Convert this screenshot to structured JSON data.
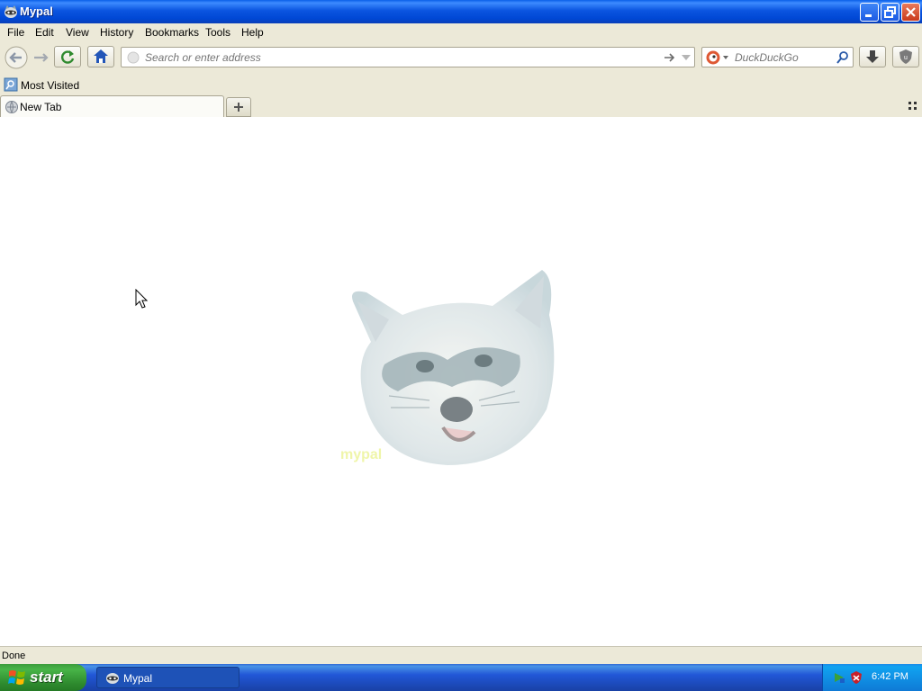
{
  "window": {
    "title": "Mypal"
  },
  "menu": [
    "File",
    "Edit",
    "View",
    "History",
    "Bookmarks",
    "Tools",
    "Help"
  ],
  "navigation": {
    "url_placeholder": "Search or enter address",
    "search_placeholder": "DuckDuckGo"
  },
  "bookmarks": {
    "most_visited": "Most Visited"
  },
  "tabs": {
    "active_label": "New Tab"
  },
  "status": {
    "text": "Done"
  },
  "taskbar": {
    "start_label": "start",
    "task_label": "Mypal",
    "clock": "6:42 PM"
  },
  "colors": {
    "titlebar": "#0a5fe8",
    "chrome_bg": "#ece9d8",
    "taskbar": "#2157d7",
    "start_green": "#3c9c3c"
  }
}
